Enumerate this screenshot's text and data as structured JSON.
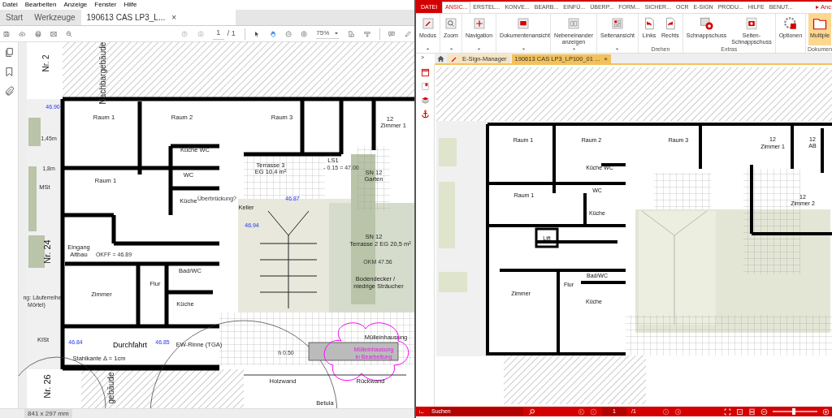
{
  "left_viewer": {
    "menu": [
      "Datei",
      "Bearbeiten",
      "Anzeige",
      "Fenster",
      "Hilfe"
    ],
    "tabs": [
      {
        "label": "Start",
        "selected": false,
        "closable": false
      },
      {
        "label": "Werkzeuge",
        "selected": false,
        "closable": false
      },
      {
        "label": "190613 CAS LP3_L...",
        "selected": true,
        "closable": true
      }
    ],
    "close_glyph": "×",
    "toolbar": {
      "page_current": "1",
      "page_total": "/ 1",
      "zoom": "75%",
      "hand_tool_selected": true
    },
    "plan": {
      "labels": [
        {
          "text": "Nr. 2",
          "kind": "vertical"
        },
        {
          "text": "Nachbargebäude",
          "kind": "vertical"
        },
        {
          "text": "Raum 1",
          "kind": "room"
        },
        {
          "text": "Raum 2",
          "kind": "room"
        },
        {
          "text": "Raum 3",
          "kind": "room"
        },
        {
          "text": "12",
          "kind": "room"
        },
        {
          "text": "Zimmer 1",
          "kind": "room"
        },
        {
          "text": "Küche WC",
          "kind": "room"
        },
        {
          "text": "Raum 1",
          "kind": "room"
        },
        {
          "text": "WC",
          "kind": "room"
        },
        {
          "text": "Küche",
          "kind": "room"
        },
        {
          "text": "Überbrückung?",
          "kind": "note"
        },
        {
          "text": "Keller",
          "kind": "room"
        },
        {
          "text": "Terrasse 3",
          "kind": "room"
        },
        {
          "text": "EG 10,4 m²",
          "kind": "room"
        },
        {
          "text": "LS1",
          "kind": "room"
        },
        {
          "text": "- 0.15 = 47.00",
          "kind": "note"
        },
        {
          "text": "SN 12",
          "kind": "room"
        },
        {
          "text": "Garten",
          "kind": "room"
        },
        {
          "text": "MSt",
          "kind": "room"
        },
        {
          "text": "46.90",
          "kind": "level"
        },
        {
          "text": "1,45m",
          "kind": "note"
        },
        {
          "text": "1,8m",
          "kind": "note"
        },
        {
          "text": "46.94",
          "kind": "level"
        },
        {
          "text": "46.87",
          "kind": "level"
        },
        {
          "text": "Nr. 24",
          "kind": "vertical-large"
        },
        {
          "text": "Eingang",
          "kind": "room"
        },
        {
          "text": "Altbau",
          "kind": "room"
        },
        {
          "text": "OKFF = 46.89",
          "kind": "note"
        },
        {
          "text": "SN 12",
          "kind": "room"
        },
        {
          "text": "Terrasse 2 EG 20,5 m²",
          "kind": "room"
        },
        {
          "text": "OKM 47.56",
          "kind": "note"
        },
        {
          "text": "Bad/WC",
          "kind": "room"
        },
        {
          "text": "Flur",
          "kind": "room"
        },
        {
          "text": "Zimmer",
          "kind": "room"
        },
        {
          "text": "Küche",
          "kind": "room"
        },
        {
          "text": "Bodendecker /",
          "kind": "room"
        },
        {
          "text": "niedrige Sträucher",
          "kind": "room"
        },
        {
          "text": "ng: Läuferreihe",
          "kind": "note"
        },
        {
          "text": "Mörtel)",
          "kind": "note"
        },
        {
          "text": "KISt",
          "kind": "room"
        },
        {
          "text": "46.84",
          "kind": "level"
        },
        {
          "text": "Durchfahrt",
          "kind": "title"
        },
        {
          "text": "46.85",
          "kind": "level"
        },
        {
          "text": "EW-Rinne (TGA)",
          "kind": "room"
        },
        {
          "text": "Stahlkante Δ = 1cm",
          "kind": "room"
        },
        {
          "text": "Mülleinhausung",
          "kind": "room"
        },
        {
          "text": "Mülleinhausung",
          "kind": "markup"
        },
        {
          "text": "in Bearbeitung",
          "kind": "markup"
        },
        {
          "text": "h 0.50",
          "kind": "note"
        },
        {
          "text": "Holzwand",
          "kind": "room"
        },
        {
          "text": "Rückwand",
          "kind": "room"
        },
        {
          "text": "Nr. 26",
          "kind": "vertical-large"
        },
        {
          "text": "gebäude",
          "kind": "vertical"
        },
        {
          "text": "Betula",
          "kind": "room"
        }
      ]
    },
    "page_size": "841 x 297 mm"
  },
  "right_viewer": {
    "ribbon_tabs": [
      {
        "label": "DATEI",
        "kind": "file",
        "selected": false
      },
      {
        "label": "ANSIC...",
        "kind": "tab",
        "selected": true
      },
      {
        "label": "ERSTEL...",
        "kind": "tab",
        "selected": false
      },
      {
        "label": "KONVE...",
        "kind": "tab",
        "selected": false
      },
      {
        "label": "BEARB...",
        "kind": "tab",
        "selected": false
      },
      {
        "label": "EINFÜ...",
        "kind": "tab",
        "selected": false
      },
      {
        "label": "ÜBERP...",
        "kind": "tab",
        "selected": false
      },
      {
        "label": "FORM...",
        "kind": "tab",
        "selected": false
      },
      {
        "label": "SICHER...",
        "kind": "tab",
        "selected": false
      },
      {
        "label": "OCR",
        "kind": "tab",
        "selected": false
      },
      {
        "label": "E-SIGN",
        "kind": "tab",
        "selected": false
      },
      {
        "label": "PRODU...",
        "kind": "tab",
        "selected": false
      },
      {
        "label": "HILFE",
        "kind": "tab",
        "selected": false
      },
      {
        "label": "BENUT...",
        "kind": "tab",
        "selected": false
      }
    ],
    "account": "▸ Anc",
    "ribbon_groups": [
      {
        "buttons": [
          {
            "label": "Modus",
            "dropdown": true,
            "selected": false
          }
        ]
      },
      {
        "buttons": [
          {
            "label": "Zoom",
            "dropdown": true,
            "selected": false
          }
        ]
      },
      {
        "buttons": [
          {
            "label": "Navigation",
            "dropdown": true,
            "selected": false
          }
        ]
      },
      {
        "buttons": [
          {
            "label": "Dokumentenansicht",
            "dropdown": true,
            "selected": false
          }
        ]
      },
      {
        "buttons": [
          {
            "label": "Nebeneinander anzeigen",
            "dropdown": true,
            "selected": false
          }
        ]
      },
      {
        "buttons": [
          {
            "label": "Seitenansicht",
            "dropdown": true,
            "selected": false
          }
        ]
      },
      {
        "label": "Drehen",
        "buttons": [
          {
            "label": "Links",
            "dropdown": false,
            "selected": false
          },
          {
            "label": "Rechts",
            "dropdown": false,
            "selected": false
          }
        ]
      },
      {
        "label": "Extras",
        "buttons": [
          {
            "label": "Schnappschuss",
            "dropdown": false,
            "selected": false
          },
          {
            "label": "Seiten-Schnappschuss",
            "dropdown": false,
            "selected": false
          }
        ]
      },
      {
        "buttons": [
          {
            "label": "Optionen",
            "dropdown": false,
            "selected": false
          }
        ]
      },
      {
        "label": "Dokumen",
        "buttons": [
          {
            "label": "Multiple",
            "dropdown": false,
            "selected": true
          }
        ]
      }
    ],
    "doc_tabs": [
      {
        "label": "E-Sign-Manager",
        "selected": false,
        "closable": false
      },
      {
        "label": "190613 CAS LP3_LP100_01 ...",
        "selected": true,
        "closable": true
      }
    ],
    "close_glyph": "×",
    "panel_toggle": ">",
    "plan": {
      "labels": [
        {
          "text": "Raum 1"
        },
        {
          "text": "Raum 2"
        },
        {
          "text": "Raum 3"
        },
        {
          "text": "12"
        },
        {
          "text": "Zimmer 1"
        },
        {
          "text": "12"
        },
        {
          "text": "AB"
        },
        {
          "text": "Küche WC"
        },
        {
          "text": "WC"
        },
        {
          "text": "Raum 1"
        },
        {
          "text": "Küche"
        },
        {
          "text": "Lift"
        },
        {
          "text": "12"
        },
        {
          "text": "Zimmer 2"
        },
        {
          "text": "Bad/WC"
        },
        {
          "text": "Flur"
        },
        {
          "text": "Zimmer"
        },
        {
          "text": "Küche"
        }
      ]
    },
    "status": {
      "search_placeholder": "Suchen",
      "page_current": "1",
      "page_total": "/1",
      "zoom_slider": {
        "level": 0.48
      }
    }
  }
}
